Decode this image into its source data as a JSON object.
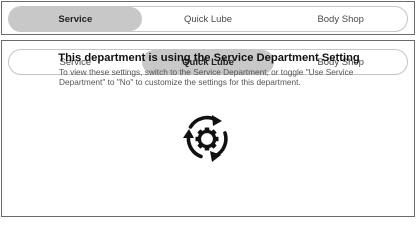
{
  "top_tabs": {
    "items": [
      {
        "label": "Service",
        "active": true
      },
      {
        "label": "Quick Lube",
        "active": false
      },
      {
        "label": "Body Shop",
        "active": false
      }
    ]
  },
  "bottom_tabs": {
    "items": [
      {
        "label": "Service",
        "active": false
      },
      {
        "label": "Quick Lube",
        "active": true
      },
      {
        "label": "Body Shop",
        "active": false
      }
    ]
  },
  "notice": {
    "title": "This department is using the Service Department Setting",
    "body": "To view these settings, switch to the Service Department, or toggle \"Use Service Department\" to \"No\" to customize the settings for this department.",
    "icon": "sync-gear-icon"
  },
  "colors": {
    "active_tab": "#c8c8c8",
    "border": "#6b6b6b",
    "icon": "#111111"
  }
}
